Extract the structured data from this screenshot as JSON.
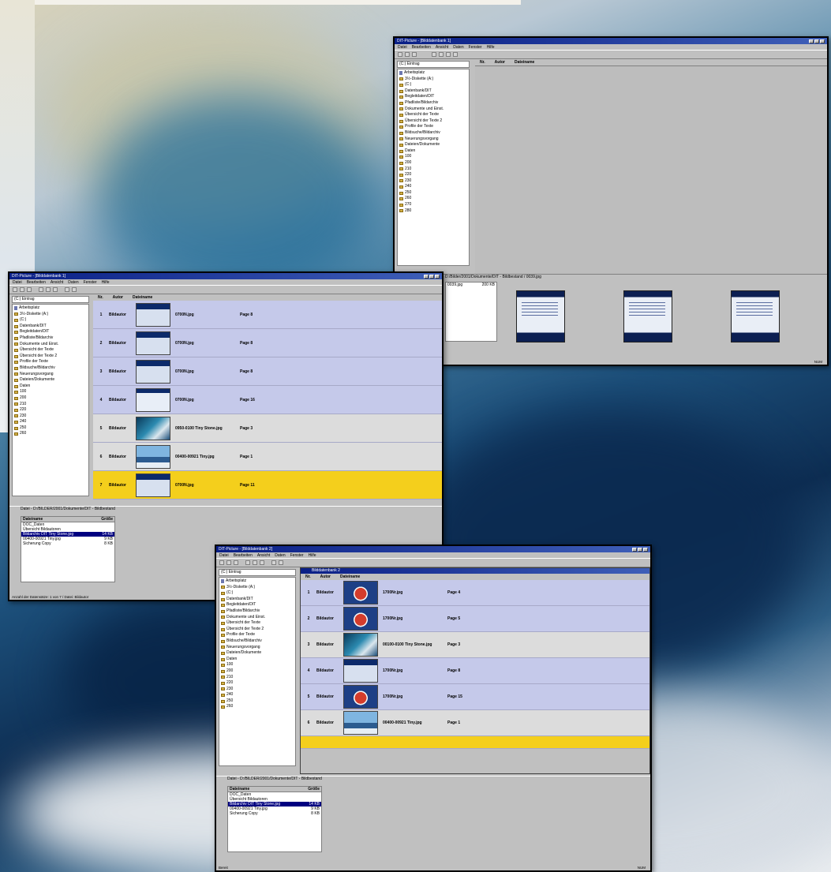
{
  "tree_items": [
    "Arbeitsplatz",
    "3½-Diskette (A:)",
    "(C:)",
    "Datenbank/DIT",
    "Begleitdaten/DIT",
    "Pfadliste/Bildarchiv",
    "Dokumente und Einst.",
    "Übersicht der Texte",
    "Übersicht der Texte 2",
    "Profile der Texte",
    "Bildsuche/Bildarchiv",
    "Neuerungsvorgang",
    "Dateien/Dokumente",
    "Daten",
    "100",
    "200",
    "210",
    "220",
    "230",
    "240",
    "250",
    "260",
    "270",
    "280"
  ],
  "col_headers": {
    "nr": "Nr.",
    "autor": "Autor",
    "dateiname": "Dateiname"
  },
  "win_top": {
    "title": "DIT-Picture - [Bilddatenbank 1]",
    "menu": [
      "Datei",
      "Bearbeiten",
      "Ansicht",
      "Daten",
      "Fenster",
      "Hilfe"
    ],
    "drive": "(C:) Eintrag",
    "path": "D:/Bilder/2001/Dokumente/DIT - Bildbestand / 0039.jpg",
    "file_small": "0039.jpg",
    "file_small_size": "200 KB",
    "status": "NUM"
  },
  "win_mid": {
    "title": "DIT-Picture - [Bilddatenbank 1]",
    "menu": [
      "Datei",
      "Bearbeiten",
      "Ansicht",
      "Daten",
      "Fenster",
      "Hilfe"
    ],
    "drive": "(C:) Eintrag",
    "rows": [
      {
        "nr": "1",
        "autor": "Bildautor",
        "file": "0700N.jpg",
        "page": "Page 8"
      },
      {
        "nr": "2",
        "autor": "Bildautor",
        "file": "0700N.jpg",
        "page": "Page 8"
      },
      {
        "nr": "3",
        "autor": "Bildautor",
        "file": "0700N.jpg",
        "page": "Page 8"
      },
      {
        "nr": "4",
        "autor": "Bildautor",
        "file": "0700N.jpg",
        "page": "Page 16"
      },
      {
        "nr": "5",
        "autor": "Bildautor",
        "file": "0950-0100 Tiny Stone.jpg",
        "page": "Page 3"
      },
      {
        "nr": "6",
        "autor": "Bildautor",
        "file": "00400-00921 Tiny.jpg",
        "page": "Page 1"
      },
      {
        "nr": "7",
        "autor": "Bildautor",
        "file": "0700N.jpg",
        "page": "Page 11"
      }
    ],
    "path": "Datei - D:/BILDER/2001/Dokumente/DIT - Bildbestand",
    "files_header": {
      "name": "Dateiname",
      "size": "Größe"
    },
    "files": [
      {
        "name": "DOC_Daten",
        "size": ""
      },
      {
        "name": "Übersicht Bildautoren",
        "size": ""
      },
      {
        "name": "Bildarchiv DIT Tiny Stone.jpg",
        "size": "14 KB"
      },
      {
        "name": "00400-00921 Tiny.jpg",
        "size": "9 KB"
      },
      {
        "name": "Sicherung Copy",
        "size": "8 KB"
      }
    ],
    "status": "Anzahl der Datensätze: 1 von 7 / Datei: Bildautor"
  },
  "win_bot": {
    "title": "DIT-Picture - [Bilddatenbank 2]",
    "menu": [
      "Datei",
      "Bearbeiten",
      "Ansicht",
      "Daten",
      "Fenster",
      "Hilfe"
    ],
    "drive": "(C:) Eintrag",
    "mdi_title": "Bilddatenbank 2",
    "rows": [
      {
        "nr": "1",
        "autor": "Bildautor",
        "file": "1700Nr.jpg",
        "page": "Page 4"
      },
      {
        "nr": "2",
        "autor": "Bildautor",
        "file": "1700Nr.jpg",
        "page": "Page 5"
      },
      {
        "nr": "3",
        "autor": "Bildautor",
        "file": "00100-0100 Tiny Stone.jpg",
        "page": "Page 3"
      },
      {
        "nr": "4",
        "autor": "Bildautor",
        "file": "1700Nr.jpg",
        "page": "Page 8"
      },
      {
        "nr": "5",
        "autor": "Bildautor",
        "file": "1700Nr.jpg",
        "page": "Page 15"
      },
      {
        "nr": "6",
        "autor": "Bildautor",
        "file": "00400-00921 Tiny.jpg",
        "page": "Page 1"
      }
    ],
    "path": "Datei - D:/BILDER/2001/Dokumente/DIT - Bildbestand",
    "files_header": {
      "name": "Dateiname",
      "size": "Größe"
    },
    "files": [
      {
        "name": "DOC_Daten",
        "size": ""
      },
      {
        "name": "Übersicht Bildautoren",
        "size": ""
      },
      {
        "name": "Bildarchiv DIT Tiny Stone.jpg",
        "size": "14 KB"
      },
      {
        "name": "00400-00921 Tiny.jpg",
        "size": "9 KB"
      },
      {
        "name": "Sicherung Copy",
        "size": "8 KB"
      }
    ],
    "status": "Bereit",
    "status_right": "NUM"
  }
}
